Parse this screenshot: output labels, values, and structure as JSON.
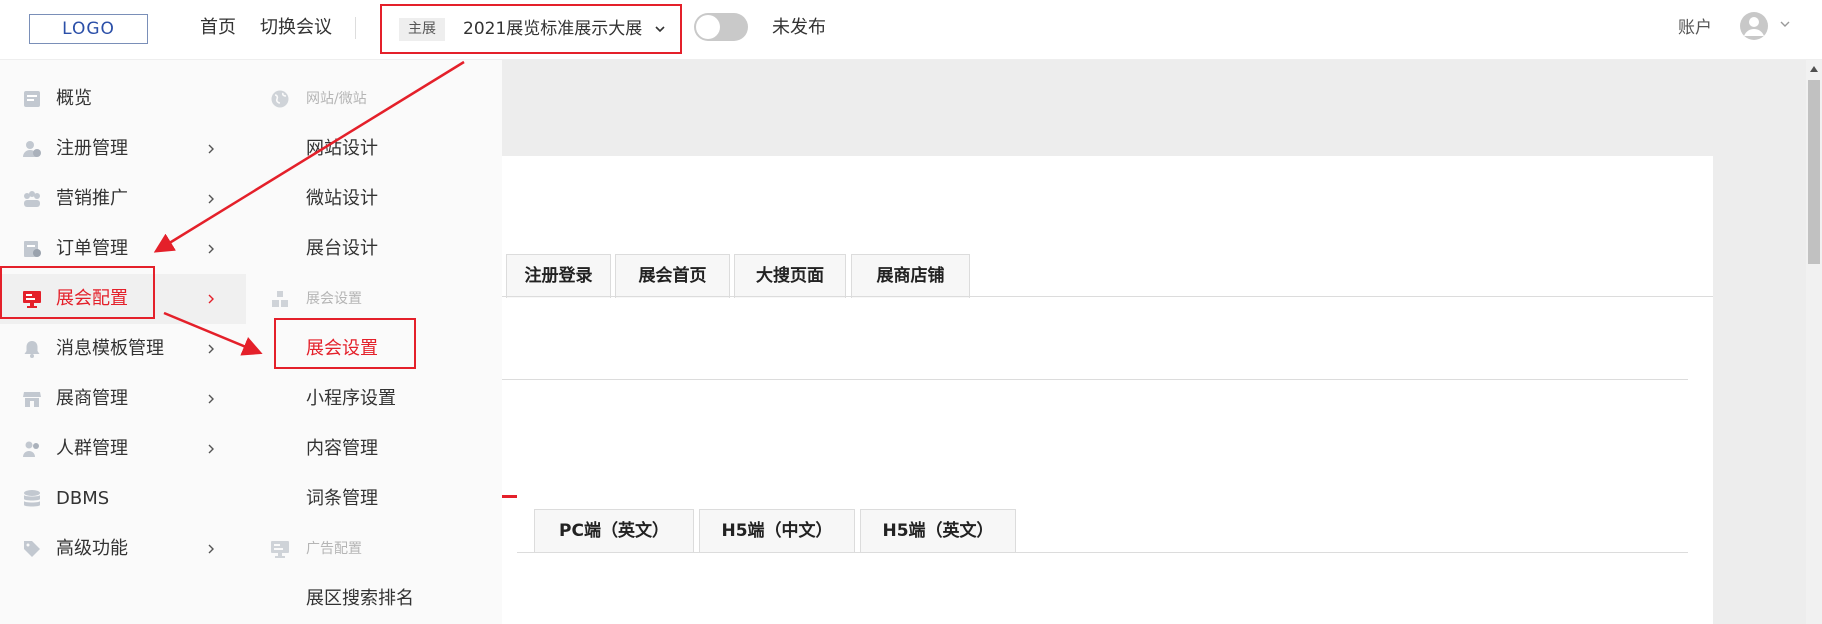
{
  "header": {
    "logo": "LOGO",
    "nav": {
      "home": "首页",
      "switch_event": "切换会议"
    },
    "event": {
      "tag": "主展",
      "name": "2021展览标准展示大展"
    },
    "publish_status": "未发布",
    "account": "账户"
  },
  "sidebar": {
    "items": [
      {
        "label": "概览",
        "icon": "overview-icon",
        "has_submenu": false
      },
      {
        "label": "注册管理",
        "icon": "user-register-icon",
        "has_submenu": true
      },
      {
        "label": "营销推广",
        "icon": "group-marketing-icon",
        "has_submenu": true
      },
      {
        "label": "订单管理",
        "icon": "order-icon",
        "has_submenu": true
      },
      {
        "label": "展会配置",
        "icon": "monitor-icon",
        "has_submenu": true,
        "active": true
      },
      {
        "label": "消息模板管理",
        "icon": "bell-icon",
        "has_submenu": true
      },
      {
        "label": "展商管理",
        "icon": "store-icon",
        "has_submenu": true
      },
      {
        "label": "人群管理",
        "icon": "people-icon",
        "has_submenu": true
      },
      {
        "label": "DBMS",
        "icon": "database-icon",
        "has_submenu": false
      },
      {
        "label": "高级功能",
        "icon": "tag-icon",
        "has_submenu": true
      }
    ]
  },
  "submenu": {
    "groups": [
      {
        "title": "网站/微站",
        "icon": "globe-icon",
        "items": [
          "网站设计",
          "微站设计",
          "展台设计"
        ]
      },
      {
        "title": "展会设置",
        "icon": "blocks-icon",
        "items": [
          "展会设置",
          "小程序设置",
          "内容管理",
          "词条管理"
        ],
        "active_item": "展会设置"
      },
      {
        "title": "广告配置",
        "icon": "ad-screen-icon",
        "items": [
          "展区搜索排名"
        ]
      }
    ]
  },
  "main": {
    "page_tabs": [
      "注册登录",
      "展会首页",
      "大搜页面",
      "展商店铺"
    ],
    "platform_tabs": [
      "PC端（英文）",
      "H5端（中文）",
      "H5端（英文）"
    ]
  },
  "colors": {
    "accent": "#e4202a",
    "menu_bg": "#fafafa",
    "content_bg": "#ededed",
    "muted_text": "#b5b5b5"
  }
}
